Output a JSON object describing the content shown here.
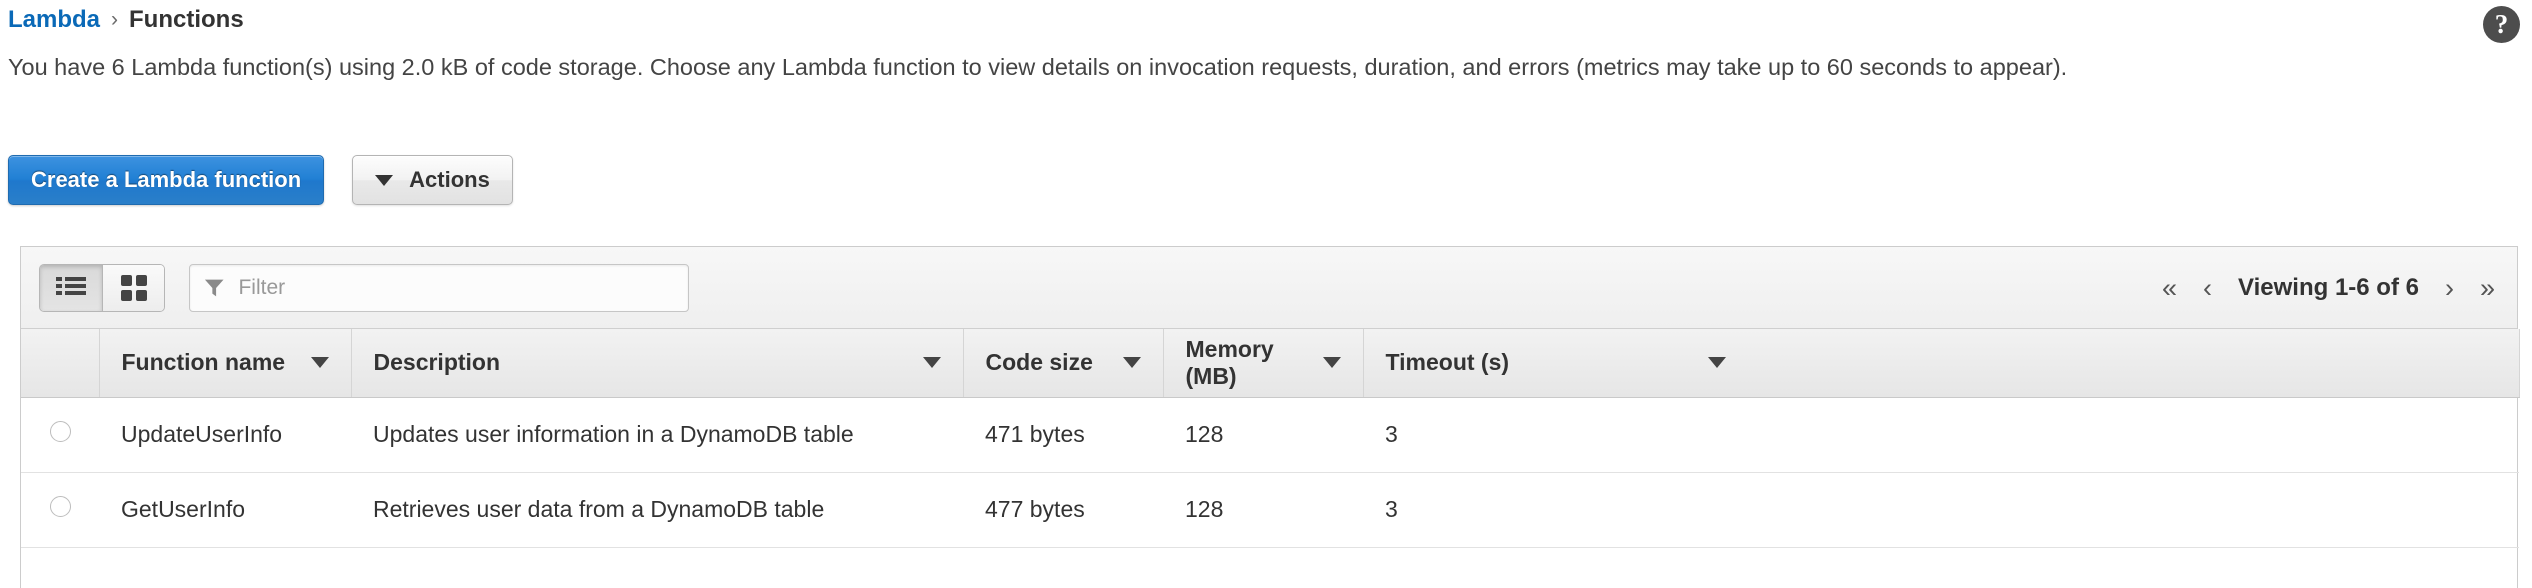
{
  "breadcrumb": {
    "root": "Lambda",
    "separator": "›",
    "current": "Functions"
  },
  "help": {
    "glyph": "?"
  },
  "description": "You have 6 Lambda function(s) using 2.0 kB of code storage. Choose any Lambda function to view details on invocation requests, duration, and errors (metrics may take up to 60 seconds to appear).",
  "toolbar": {
    "create_button": "Create a Lambda function",
    "actions_button": "Actions"
  },
  "panel": {
    "filter": {
      "placeholder": "Filter",
      "value": ""
    },
    "view": {
      "list": "list-view",
      "grid": "grid-view",
      "active": "list"
    },
    "pagination": {
      "first": "«",
      "prev": "‹",
      "label": "Viewing 1-6 of 6",
      "next": "›",
      "last": "»"
    }
  },
  "table": {
    "columns": [
      {
        "label": "Function name",
        "sortable": true
      },
      {
        "label": "Description",
        "sortable": true
      },
      {
        "label": "Code size",
        "sortable": true
      },
      {
        "label": "Memory (MB)",
        "sortable": true
      },
      {
        "label": "Timeout (s)",
        "sortable": true
      }
    ],
    "rows": [
      {
        "name": "UpdateUserInfo",
        "description": "Updates user information in a DynamoDB table",
        "code_size": "471 bytes",
        "memory": "128",
        "timeout": "3"
      },
      {
        "name": "GetUserInfo",
        "description": "Retrieves user data from a DynamoDB table",
        "code_size": "477 bytes",
        "memory": "128",
        "timeout": "3"
      }
    ]
  },
  "colors": {
    "link": "#0a69b7",
    "primary_button": "#2180d4",
    "text": "#333333"
  }
}
